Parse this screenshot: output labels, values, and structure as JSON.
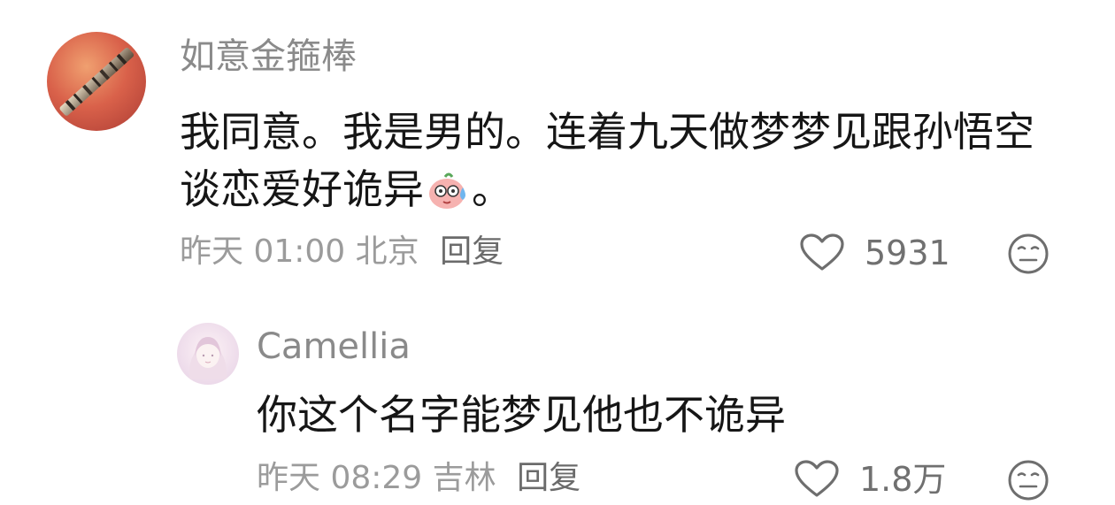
{
  "comments": [
    {
      "username": "如意金箍棒",
      "avatar_icon": "golden-staff-avatar",
      "text_before_emoji": "我同意。我是男的。连着九天做梦梦见跟孙悟空谈恋爱好诡异",
      "emoji_icon": "sweating-pig-emoji",
      "text_after_emoji": "。",
      "time": "昨天 01:00",
      "location": "北京",
      "reply_label": "回复",
      "likes": "5931",
      "like_icon": "heart-outline-icon",
      "dislike_icon": "neutral-face-icon"
    },
    {
      "username": "Camellia",
      "avatar_icon": "girl-portrait-avatar",
      "text": "你这个名字能梦见他也不诡异",
      "time": "昨天 08:29",
      "location": "吉林",
      "reply_label": "回复",
      "likes": "1.8万",
      "like_icon": "heart-outline-icon",
      "dislike_icon": "neutral-face-icon"
    }
  ],
  "colors": {
    "username": "#8a8a8a",
    "body": "#161616",
    "meta": "#9b9b9b",
    "icon": "#707070",
    "background": "#ffffff"
  }
}
